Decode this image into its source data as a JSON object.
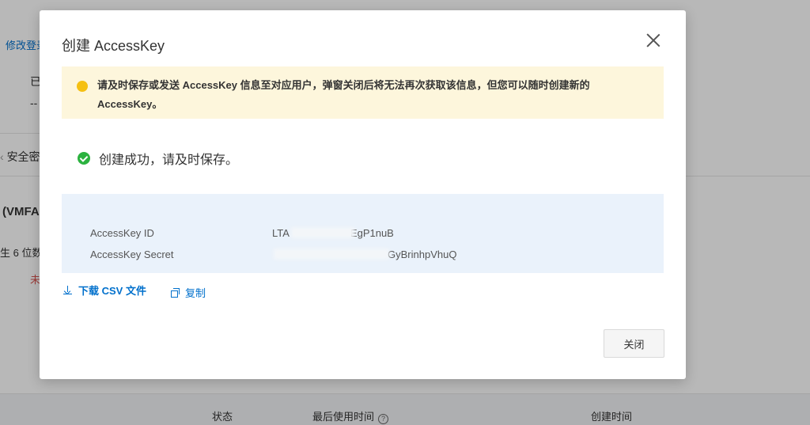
{
  "background": {
    "link": "修改登录",
    "text1": "已",
    "text2": "--",
    "tab": "安全密",
    "heading": "(VMFA",
    "desc": "生 6 位数",
    "status": "未",
    "table_headers": {
      "status": "状态",
      "last_used": "最后使用时间",
      "created": "创建时间"
    }
  },
  "modal": {
    "title": "创建 AccessKey",
    "warning": "请及时保存或发送 AccessKey 信息至对应用户，弹窗关闭后将无法再次获取该信息，但您可以随时创建新的 AccessKey。",
    "success": "创建成功，请及时保存。",
    "fields": {
      "id_label": "AccessKey ID",
      "id_value_prefix": "LTA",
      "id_value_suffix": "EgP1nuB",
      "secret_label": "AccessKey Secret",
      "secret_value_suffix": "GyBrinhpVhuQ"
    },
    "actions": {
      "download": "下载 CSV 文件",
      "copy": "复制"
    },
    "close_button": "关闭"
  },
  "colors": {
    "link": "#0070cc",
    "warning_bg": "#fdf6dc",
    "warning_dot": "#f5c012",
    "success": "#2bb23f",
    "key_box_bg": "#eaf2fb"
  }
}
